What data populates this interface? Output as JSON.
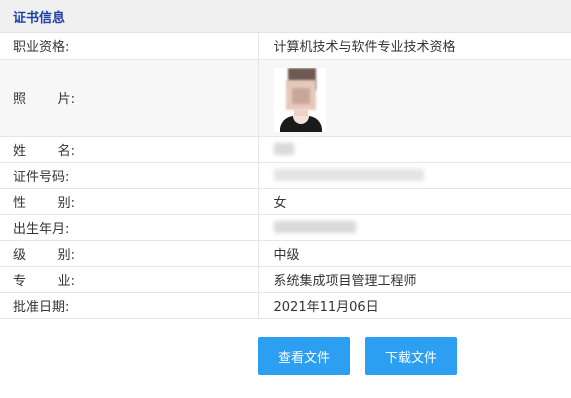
{
  "header": {
    "title": "证书信息"
  },
  "rows": {
    "qualification": {
      "label": "职业资格:",
      "value": "计算机技术与软件专业技术资格"
    },
    "photo": {
      "label_a": "照",
      "label_b": "片:"
    },
    "name": {
      "label_a": "姓",
      "label_b": "名:",
      "value": ""
    },
    "cert_no": {
      "label": "证件号码:",
      "value": ""
    },
    "gender": {
      "label_a": "性",
      "label_b": "别:",
      "value": "女"
    },
    "birth": {
      "label": "出生年月:",
      "value": ""
    },
    "level": {
      "label_a": "级",
      "label_b": "别:",
      "value": "中级"
    },
    "major": {
      "label_a": "专",
      "label_b": "业:",
      "value": "系统集成项目管理工程师"
    },
    "approval_date": {
      "label": "批准日期:",
      "value": "2021年11月06日"
    }
  },
  "actions": {
    "view_file": "查看文件",
    "download_file": "下载文件"
  },
  "colors": {
    "header_text": "#1d3fa8",
    "button_bg": "#2c9ff2",
    "header_bg": "#f0f0f0"
  }
}
